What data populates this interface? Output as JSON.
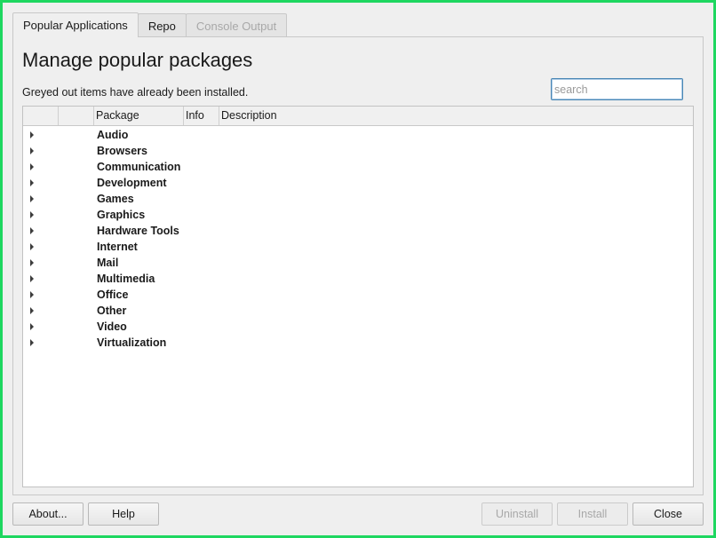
{
  "tabs": [
    {
      "label": "Popular Applications",
      "state": "active"
    },
    {
      "label": "Repo",
      "state": "normal"
    },
    {
      "label": "Console Output",
      "state": "disabled"
    }
  ],
  "main": {
    "title": "Manage popular packages",
    "note": "Greyed out items have already been installed.",
    "search_placeholder": "search"
  },
  "tree": {
    "columns": [
      "",
      "",
      "Package",
      "Info",
      "Description"
    ],
    "categories": [
      "Audio",
      "Browsers",
      "Communication",
      "Development",
      "Games",
      "Graphics",
      "Hardware Tools",
      "Internet",
      "Mail",
      "Multimedia",
      "Office",
      "Other",
      "Video",
      "Virtualization"
    ]
  },
  "buttons": {
    "about": "About...",
    "help": "Help",
    "uninstall": "Uninstall",
    "install": "Install",
    "close": "Close"
  },
  "colors": {
    "accent_border": "#1ed760",
    "focus": "#4a87b5",
    "disabled_text": "#a8a8a8"
  }
}
